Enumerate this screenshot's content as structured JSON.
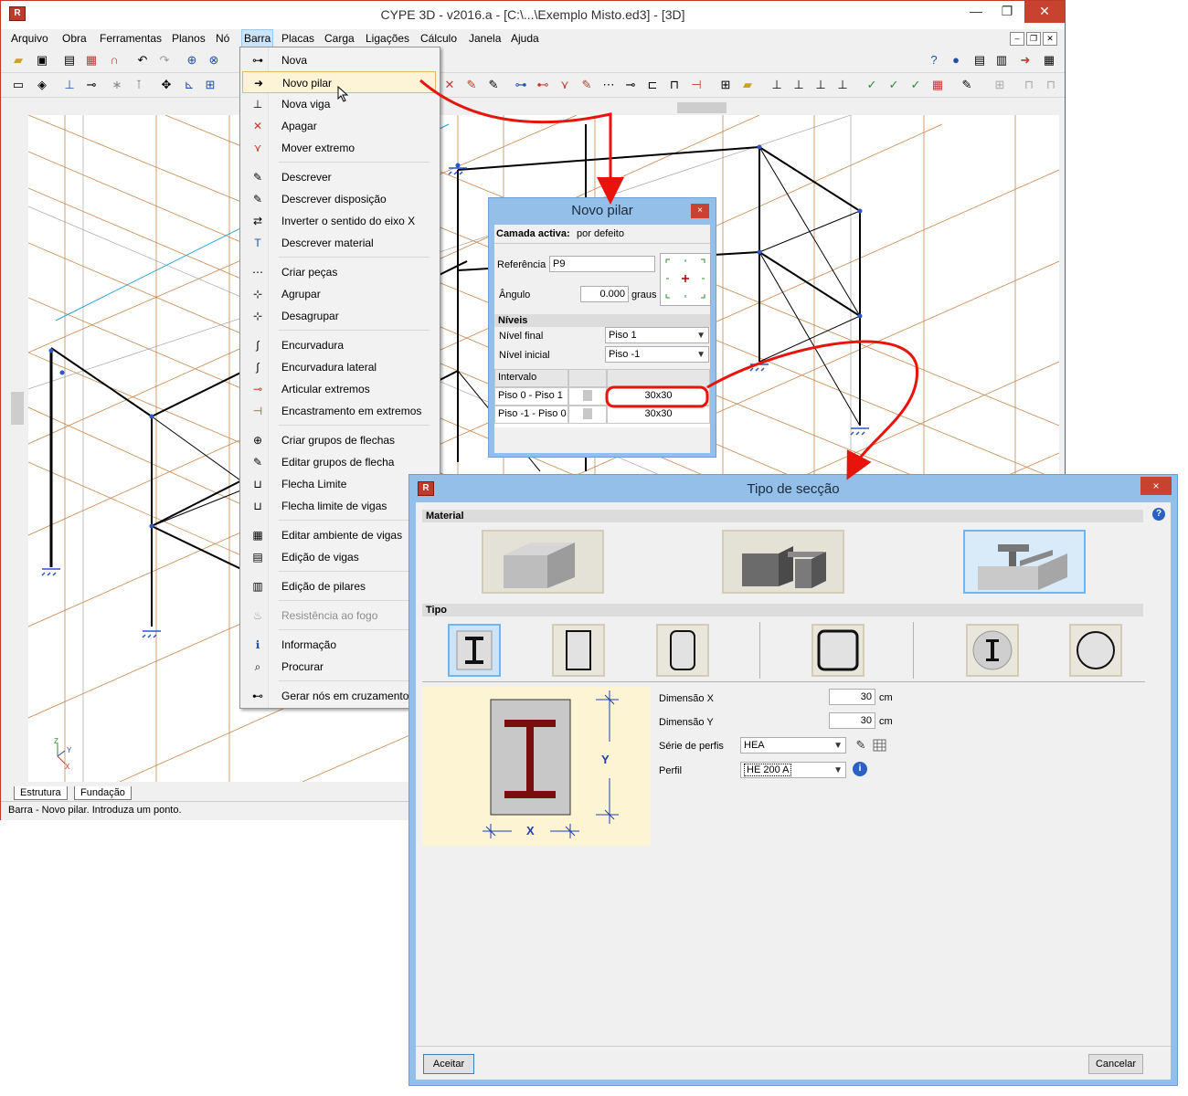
{
  "main_window": {
    "title": "CYPE 3D - v2016.a - [C:\\...\\Exemplo Misto.ed3] - [3D]",
    "menu": [
      "Arquivo",
      "Obra",
      "Ferramentas",
      "Planos",
      "Nó",
      "Barra",
      "Placas",
      "Carga",
      "Ligações",
      "Cálculo",
      "Janela",
      "Ajuda"
    ],
    "active_menu": "Barra",
    "tabs": [
      "Estrutura",
      "Fundação"
    ],
    "status": "Barra - Novo pilar.  Introduza um ponto."
  },
  "barra_menu": {
    "items": [
      {
        "label": "Nova",
        "icon": "new-bar-icon"
      },
      {
        "label": "Novo pilar",
        "icon": "arrow-right-icon",
        "selected": true
      },
      {
        "label": "Nova viga",
        "icon": "new-beam-icon"
      },
      {
        "label": "Apagar",
        "icon": "delete-icon"
      },
      {
        "label": "Mover extremo",
        "icon": "move-end-icon"
      },
      {
        "label": "Descrever",
        "icon": "describe-icon"
      },
      {
        "label": "Descrever disposição",
        "icon": "describe-layout-icon"
      },
      {
        "label": "Inverter o sentido do eixo X",
        "icon": "invert-axis-icon"
      },
      {
        "label": "Descrever material",
        "icon": "material-icon"
      },
      {
        "label": "Criar peças",
        "icon": "create-pieces-icon"
      },
      {
        "label": "Agrupar",
        "icon": "group-icon"
      },
      {
        "label": "Desagrupar",
        "icon": "ungroup-icon"
      },
      {
        "label": "Encurvadura",
        "icon": "buckling-icon"
      },
      {
        "label": "Encurvadura lateral",
        "icon": "lateral-buckling-icon"
      },
      {
        "label": "Articular extremos",
        "icon": "hinge-icon"
      },
      {
        "label": "Encastramento em extremos",
        "icon": "fixed-end-icon"
      },
      {
        "label": "Criar grupos de flechas",
        "icon": "deflection-group-icon"
      },
      {
        "label": "Editar grupos de flecha",
        "icon": "edit-deflection-icon"
      },
      {
        "label": "Flecha Limite",
        "icon": "deflection-limit-icon"
      },
      {
        "label": "Flecha limite de vigas",
        "icon": "beam-deflection-icon"
      },
      {
        "label": "Editar ambiente de vigas",
        "icon": "beam-env-icon"
      },
      {
        "label": "Edição de vigas",
        "icon": "edit-beams-icon"
      },
      {
        "label": "Edição de pilares",
        "icon": "edit-columns-icon"
      },
      {
        "label": "Resistência ao fogo",
        "icon": "fire-icon",
        "disabled": true
      },
      {
        "label": "Informação",
        "icon": "info-icon"
      },
      {
        "label": "Procurar",
        "icon": "search-icon"
      },
      {
        "label": "Gerar nós em cruzamentos",
        "icon": "nodes-icon"
      }
    ]
  },
  "novo_pilar": {
    "title": "Novo pilar",
    "close": "×",
    "layer_label": "Camada activa:",
    "layer_value": "por defeito",
    "reference_label": "Referência",
    "reference_value": "P9",
    "angle_label": "Ângulo",
    "angle_value": "0.000",
    "angle_unit": "graus",
    "levels_header": "Níveis",
    "final_label": "Nível final",
    "final_value": "Piso 1",
    "initial_label": "Nível inicial",
    "initial_value": "Piso -1",
    "interval_header": "Intervalo",
    "rows": [
      {
        "interval": "Piso 0 - Piso 1",
        "section": "30x30"
      },
      {
        "interval": "Piso -1 - Piso 0",
        "section": "30x30"
      }
    ]
  },
  "tipo_seccao": {
    "title": "Tipo de secção",
    "close": "×",
    "help": "?",
    "material_header": "Material",
    "tipo_header": "Tipo",
    "materials": [
      "concrete-block-icon",
      "steel-section-icon",
      "mixed-section-icon"
    ],
    "selected_material": 2,
    "types": [
      "i-section-icon",
      "rectangle-section-icon",
      "rounded-rect-section-icon",
      "hollow-square-icon",
      "i-circle-icon",
      "circle-section-icon"
    ],
    "selected_type": 0,
    "diagram": {
      "x_label": "X",
      "y_label": "Y"
    },
    "dim_x_label": "Dimensão X",
    "dim_x_value": "30",
    "dim_y_label": "Dimensão Y",
    "dim_y_value": "30",
    "unit": "cm",
    "series_label": "Série de perfis",
    "series_value": "HEA",
    "profile_label": "Perfil",
    "profile_value": "HE 200 A",
    "accept": "Aceitar",
    "cancel": "Cancelar"
  },
  "colors": {
    "accent_red": "#e8140c",
    "title_blue": "#93bfe8",
    "close_red": "#c7422f",
    "wire_orange": "#c8874c",
    "steel_dark": "#7a0e0e"
  }
}
